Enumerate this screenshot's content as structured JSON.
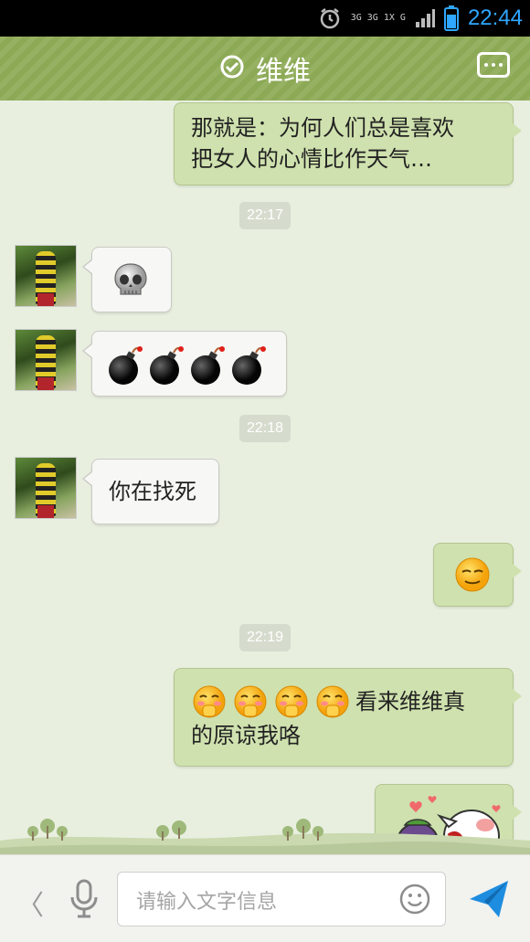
{
  "status_bar": {
    "network_label": "3G 3G 1X G",
    "time": "22:44"
  },
  "header": {
    "title": "维维",
    "status_icon": "check-circle-icon",
    "menu_icon": "more-options-icon"
  },
  "messages": [
    {
      "side": "right",
      "type": "text",
      "text_line1": "那就是：为何人们总是喜欢",
      "text_line2": "把女人的心情比作天气…"
    },
    {
      "type": "timestamp",
      "text": "22:17"
    },
    {
      "side": "left",
      "type": "emoji",
      "emoji": "💀",
      "icon": "skull-icon"
    },
    {
      "side": "left",
      "type": "emoji",
      "emoji": "💣💣💣💣",
      "icon": "bomb-icon"
    },
    {
      "type": "timestamp",
      "text": "22:18"
    },
    {
      "side": "left",
      "type": "text",
      "text": "你在找死"
    },
    {
      "side": "right",
      "type": "emoji",
      "emoji": "😌",
      "icon": "relieved-face-icon"
    },
    {
      "type": "timestamp",
      "text": "22:19"
    },
    {
      "side": "right",
      "type": "text",
      "emoji_prefix": "🤭🤭🤭🤭",
      "text_line1": "看来维维真",
      "text_line2": "的原谅我咯"
    },
    {
      "side": "right",
      "type": "sticker",
      "icon": "cartoon-sticker-icon"
    }
  ],
  "input_bar": {
    "back_glyph": "〈",
    "placeholder": "请输入文字信息",
    "voice_icon": "microphone-icon",
    "emoji_icon": "smiley-icon",
    "send_icon": "send-icon"
  },
  "colors": {
    "header": "#8fac58",
    "outgoing_bubble": "#cfe1ae",
    "incoming_bubble": "#f7f7f5",
    "time_accent": "#2fa6ff"
  }
}
